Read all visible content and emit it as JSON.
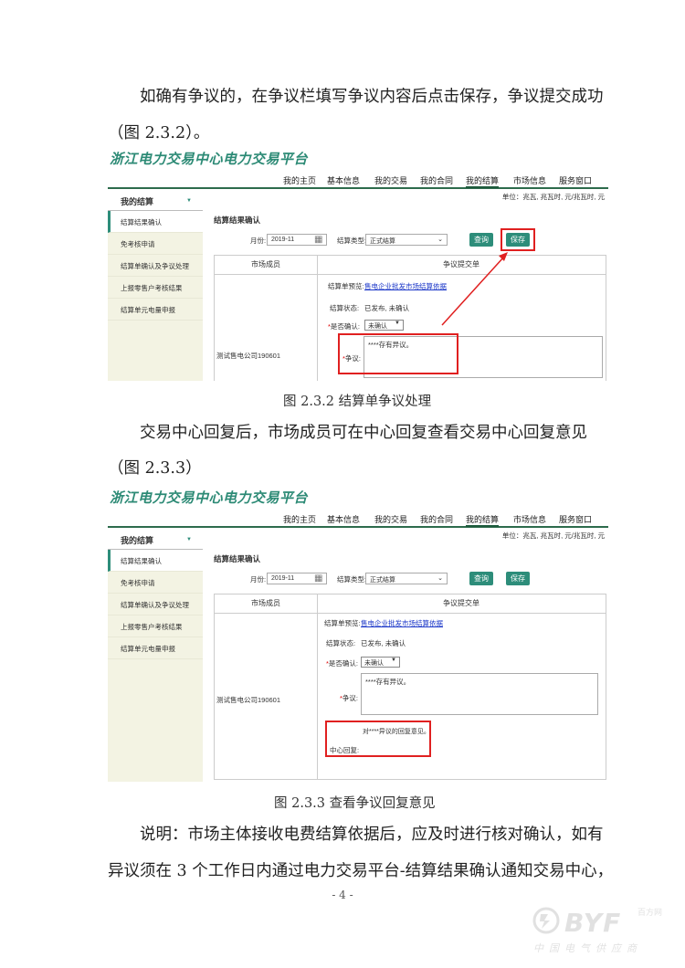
{
  "paragraphs": {
    "p1": "如确有争议的，在争议栏填写争议内容后点击保存，争议提交成功",
    "p1b": "（图 2.3.2）。",
    "p2": "交易中心回复后，市场成员可在中心回复查看交易中心回复意见",
    "p2b": "（图 2.3.3）",
    "p3": "说明：市场主体接收电费结算依据后，应及时进行核对确认，如有",
    "p3b": "异议须在 3 个工作日内通过电力交易平台-结算结果确认通知交易中心，"
  },
  "captions": {
    "fig1": "图 2.3.2  结算单争议处理",
    "fig2": "图 2.3.3  查看争议回复意见"
  },
  "screen": {
    "brand": "浙江电力交易中心电力交易平台",
    "nav": [
      "我的主页",
      "基本信息",
      "我的交易",
      "我的合同",
      "我的结算",
      "市场信息",
      "服务窗口"
    ],
    "unit": "单位：兆瓦, 兆瓦时, 元/兆瓦时, 元",
    "side_head": "我的结算",
    "side_items": [
      "结算结果确认",
      "免考核申请",
      "结算单确认及争议处理",
      "上报零售户考核结果",
      "结算单元电量申报"
    ],
    "section_title": "结算结果确认",
    "month_label": "月份:",
    "month_value": "2019-11",
    "type_label": "结算类型:",
    "type_value": "正式结算",
    "query_btn": "查询",
    "save_btn": "保存",
    "col_member": "市场成员",
    "col_dispute": "争议提交单",
    "member_name": "测试售电公司190601",
    "preview_label": "结算单预览:",
    "preview_link": "售电企业批发市场结算依据",
    "status_label": "结算状态:",
    "status_value": "已发布, 未确认",
    "confirm_label": "是否确认:",
    "confirm_value": "未确认",
    "dispute_label": "争议:",
    "dispute_text": "****存有异议。",
    "reply_label": "中心回复:",
    "reply_text": "对****异议的回复意见。"
  },
  "footer": {
    "page_num": "- 4 -"
  },
  "watermark": {
    "brand": "BYF",
    "small": "百方网",
    "slogan": "中国电气供应商"
  }
}
